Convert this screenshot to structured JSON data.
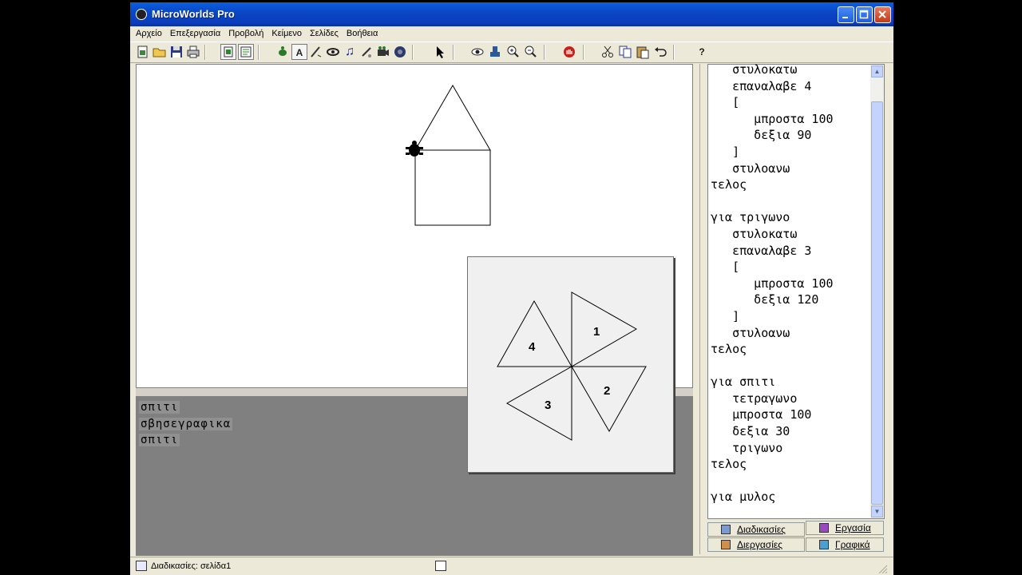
{
  "window": {
    "title": "MicroWorlds Pro"
  },
  "menu": [
    "Αρχείο",
    "Επεξεργασία",
    "Προβολή",
    "Κείμενο",
    "Σελίδες",
    "Βοήθεια"
  ],
  "toolbar": {
    "icons": [
      "new-page-icon",
      "open-icon",
      "save-icon",
      "print-icon",
      "page-view-icon",
      "text-view-icon",
      "turtle-icon",
      "text-box-icon",
      "paint-icon",
      "stamp-icon",
      "music-icon",
      "draw-icon",
      "video-icon",
      "sound-icon",
      "pointer-icon",
      "eye-icon",
      "stamp-shape-icon",
      "zoom-in-icon",
      "zoom-out-icon",
      "stop-icon",
      "cut-icon",
      "copy-icon",
      "paste-icon",
      "undo-icon",
      "help-icon"
    ],
    "help_label": "?",
    "text_tool_label": "A"
  },
  "command_center": {
    "lines": [
      "σπιτι",
      "σβησεγραφικα",
      "σπιτι"
    ]
  },
  "shapes_panel": {
    "labels": [
      "1",
      "2",
      "3",
      "4"
    ]
  },
  "procedures": {
    "lines": [
      "   στυλοκατω",
      "   επαναλαβε 4",
      "   [",
      "      μπροστα 100",
      "      δεξια 90",
      "   ]",
      "   στυλοανω",
      "τελος",
      "",
      "για τριγωνο",
      "   στυλοκατω",
      "   επαναλαβε 3",
      "   [",
      "      μπροστα 100",
      "      δεξια 120",
      "   ]",
      "   στυλοανω",
      "τελος",
      "",
      "για σπιτι",
      "   τετραγωνο",
      "   μπροστα 100",
      "   δεξια 30",
      "   τριγωνο",
      "τελος",
      "",
      "για μυλος"
    ]
  },
  "tabs": {
    "procedures": "Διαδικασίες",
    "project": "Εργασία",
    "processes": "Διεργασίες",
    "graphics": "Γραφικά"
  },
  "status": {
    "text": "Διαδικασίες:  σελίδα1"
  },
  "colors": {
    "titlebar": "#0a47c6",
    "command_center_bg": "#808080",
    "canvas_bg": "#ffffff"
  }
}
